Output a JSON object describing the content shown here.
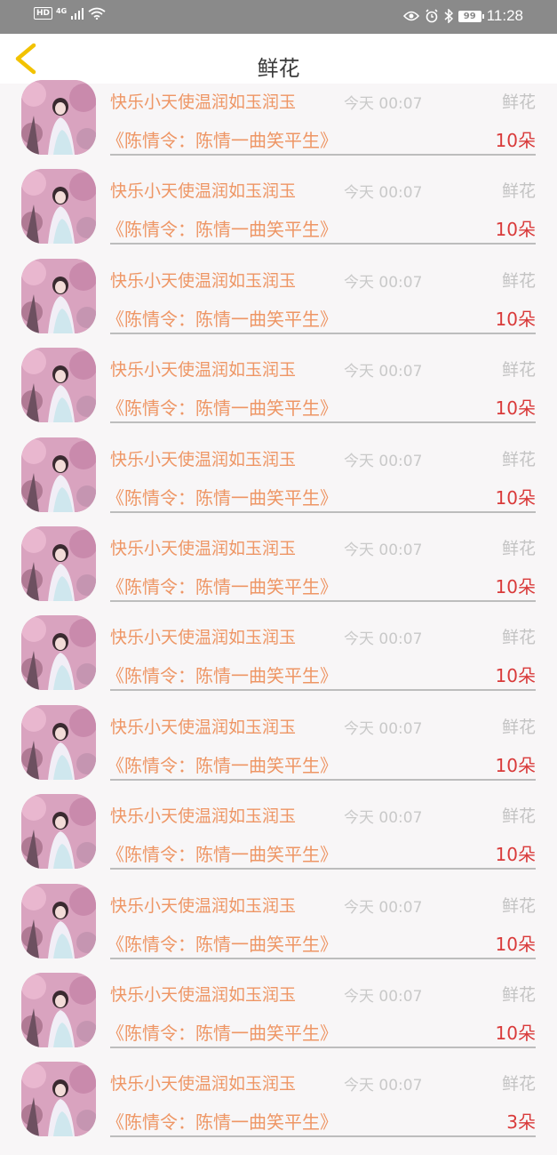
{
  "status_bar": {
    "hd": "HD",
    "network": "4G",
    "battery": "99",
    "time": "11:28"
  },
  "header": {
    "title": "鲜花",
    "back_icon": "chevron-left-icon",
    "back_color": "#f2c200"
  },
  "colors": {
    "name": "#ee9665",
    "time": "#c9c9c9",
    "type": "#c3c3c3",
    "count": "#d93a3a"
  },
  "items": [
    {
      "name": "快乐小天使温润如玉润玉",
      "time": "今天 00:07",
      "type": "鲜花",
      "show": "《陈情令：陈情一曲笑平生》",
      "count": "10朵"
    },
    {
      "name": "快乐小天使温润如玉润玉",
      "time": "今天 00:07",
      "type": "鲜花",
      "show": "《陈情令：陈情一曲笑平生》",
      "count": "10朵"
    },
    {
      "name": "快乐小天使温润如玉润玉",
      "time": "今天 00:07",
      "type": "鲜花",
      "show": "《陈情令：陈情一曲笑平生》",
      "count": "10朵"
    },
    {
      "name": "快乐小天使温润如玉润玉",
      "time": "今天 00:07",
      "type": "鲜花",
      "show": "《陈情令：陈情一曲笑平生》",
      "count": "10朵"
    },
    {
      "name": "快乐小天使温润如玉润玉",
      "time": "今天 00:07",
      "type": "鲜花",
      "show": "《陈情令：陈情一曲笑平生》",
      "count": "10朵"
    },
    {
      "name": "快乐小天使温润如玉润玉",
      "time": "今天 00:07",
      "type": "鲜花",
      "show": "《陈情令：陈情一曲笑平生》",
      "count": "10朵"
    },
    {
      "name": "快乐小天使温润如玉润玉",
      "time": "今天 00:07",
      "type": "鲜花",
      "show": "《陈情令：陈情一曲笑平生》",
      "count": "10朵"
    },
    {
      "name": "快乐小天使温润如玉润玉",
      "time": "今天 00:07",
      "type": "鲜花",
      "show": "《陈情令：陈情一曲笑平生》",
      "count": "10朵"
    },
    {
      "name": "快乐小天使温润如玉润玉",
      "time": "今天 00:07",
      "type": "鲜花",
      "show": "《陈情令：陈情一曲笑平生》",
      "count": "10朵"
    },
    {
      "name": "快乐小天使温润如玉润玉",
      "time": "今天 00:07",
      "type": "鲜花",
      "show": "《陈情令：陈情一曲笑平生》",
      "count": "10朵"
    },
    {
      "name": "快乐小天使温润如玉润玉",
      "time": "今天 00:07",
      "type": "鲜花",
      "show": "《陈情令：陈情一曲笑平生》",
      "count": "10朵"
    },
    {
      "name": "快乐小天使温润如玉润玉",
      "time": "今天 00:07",
      "type": "鲜花",
      "show": "《陈情令：陈情一曲笑平生》",
      "count": "3朵"
    }
  ]
}
